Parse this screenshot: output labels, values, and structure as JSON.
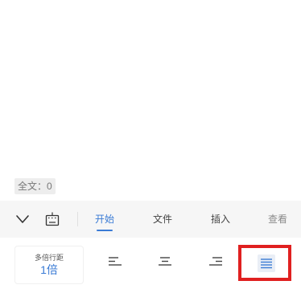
{
  "document": {
    "word_count": "全文：0"
  },
  "toolbar": {
    "icons": [
      "chevron-down-icon",
      "keyboard-icon"
    ],
    "tabs": [
      {
        "label": "开始",
        "active": true
      },
      {
        "label": "文件",
        "active": false
      },
      {
        "label": "插入",
        "active": false
      },
      {
        "label": "查看",
        "active": false
      }
    ]
  },
  "format": {
    "line_spacing_label": "多倍行距",
    "line_spacing_value": "1倍",
    "alignments": [
      "align-left-icon",
      "align-center-icon",
      "align-right-icon",
      "align-justify-icon"
    ],
    "selected_alignment": "align-justify-icon"
  },
  "colors": {
    "accent": "#3a7bd5",
    "highlight": "#e02020",
    "toolbar_bg": "#f6f6f6"
  }
}
